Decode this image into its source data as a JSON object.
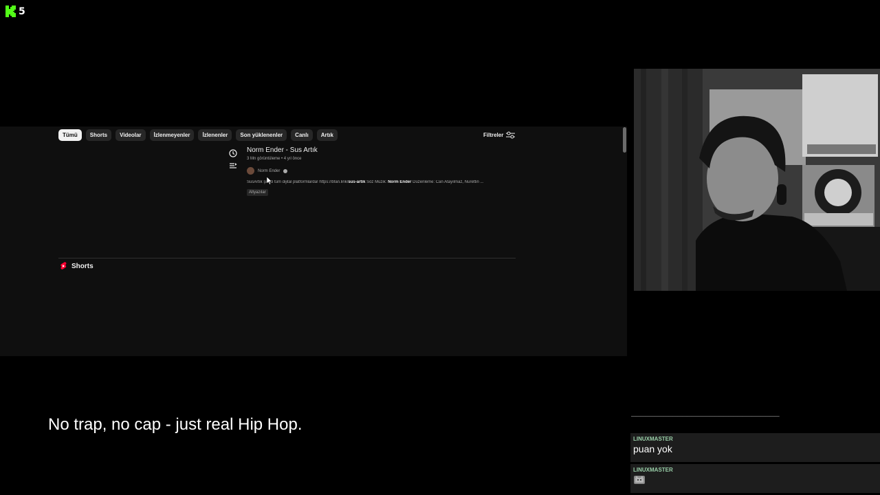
{
  "overlay": {
    "viewer_count": "5",
    "caption": "No trap, no cap - just real Hip Hop."
  },
  "browser": {
    "chips": [
      "Tümü",
      "Shorts",
      "Videolar",
      "İzlenmeyenler",
      "İzlenenler",
      "Son yüklenenler",
      "Canlı",
      "Artık"
    ],
    "active_chip": "Tümü",
    "filters_label": "Filtreler",
    "result": {
      "title": "Norm Ender - Sus Artık",
      "meta": "3 Mn görüntüleme • 4 yıl önce",
      "channel": "Norm Ender",
      "description_prefix": "SusArtık şimdi tüm dijital platformlarda! https://bfan.link/",
      "description_bold1": "sus-artik",
      "description_mid": " Söz Müzik: ",
      "description_bold2": "Norm Ender",
      "description_suffix": " Düzenleme: Can Atayılmaz, Nurettin ...",
      "badge": "Altyazılar"
    },
    "shorts_label": "Shorts"
  },
  "chat": {
    "separator": "________________________________",
    "messages": [
      {
        "user": "LINUXMASTER",
        "text": "puan yok"
      },
      {
        "user": "LINUXMASTER",
        "text": "",
        "emote": "cat-emote"
      }
    ]
  },
  "colors": {
    "kick_green": "#53fc18",
    "yt_background": "#0f0f0f",
    "chip_bg": "#272727",
    "shorts_red": "#ff0033",
    "chat_username": "#9ad0a9"
  }
}
